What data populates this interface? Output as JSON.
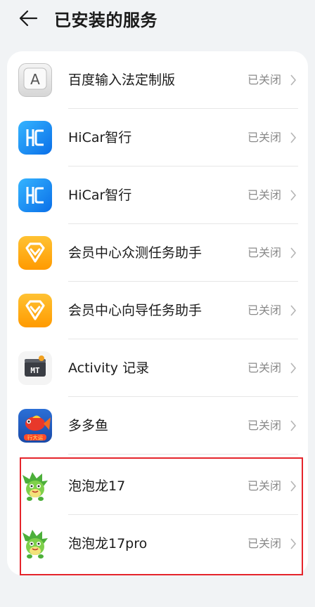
{
  "header": {
    "title": "已安装的服务"
  },
  "colors": {
    "highlight": "#e5242b",
    "status_text": "#8a8a8a",
    "card": "#ffffff",
    "background": "#f1f3f5"
  },
  "items": [
    {
      "name": "百度输入法定制版",
      "status": "已关闭",
      "icon": "baidu-input-icon"
    },
    {
      "name": "HiCar智行",
      "status": "已关闭",
      "icon": "hicar-icon"
    },
    {
      "name": "HiCar智行",
      "status": "已关闭",
      "icon": "hicar-icon"
    },
    {
      "name": "会员中心众测任务助手",
      "status": "已关闭",
      "icon": "member-diamond-icon"
    },
    {
      "name": "会员中心向导任务助手",
      "status": "已关闭",
      "icon": "member-diamond-icon"
    },
    {
      "name": "Activity 记录",
      "status": "已关闭",
      "icon": "mt-icon"
    },
    {
      "name": "多多鱼",
      "status": "已关闭",
      "icon": "fish-game-icon",
      "icon_text": "行大运"
    },
    {
      "name": "泡泡龙17",
      "status": "已关闭",
      "icon": "dragon-icon"
    },
    {
      "name": "泡泡龙17pro",
      "status": "已关闭",
      "icon": "dragon-icon"
    }
  ]
}
